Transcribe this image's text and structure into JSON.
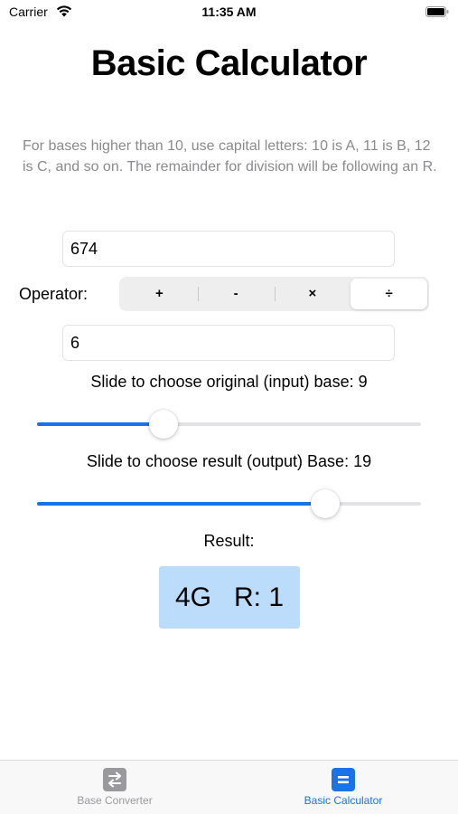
{
  "status_bar": {
    "carrier": "Carrier",
    "time": "11:35 AM"
  },
  "title": "Basic Calculator",
  "help_text": "For bases higher than 10, use capital letters: 10 is A, 11 is B, 12 is C, and so on. The remainder for division will be following an R.",
  "first_number": {
    "value": "674"
  },
  "operator": {
    "label": "Operator:",
    "options": [
      "+",
      "-",
      "×",
      "÷"
    ],
    "selected": "÷"
  },
  "second_number": {
    "value": "6"
  },
  "input_base": {
    "label": "Slide to choose original (input) base: 9",
    "value": 9,
    "fraction": 0.33
  },
  "output_base": {
    "label": "Slide to choose result (output) Base: 19",
    "value": 19,
    "fraction": 0.75
  },
  "result": {
    "label": "Result:",
    "value": "4G   R: 1"
  },
  "tabs": [
    {
      "label": "Base Converter",
      "icon": "swap-arrows-icon",
      "active": false
    },
    {
      "label": "Basic Calculator",
      "icon": "equals-icon",
      "active": true
    }
  ],
  "colors": {
    "accent": "#1a73e8",
    "result_bg": "#bcdcfb",
    "help_text": "#8a8a8e"
  }
}
